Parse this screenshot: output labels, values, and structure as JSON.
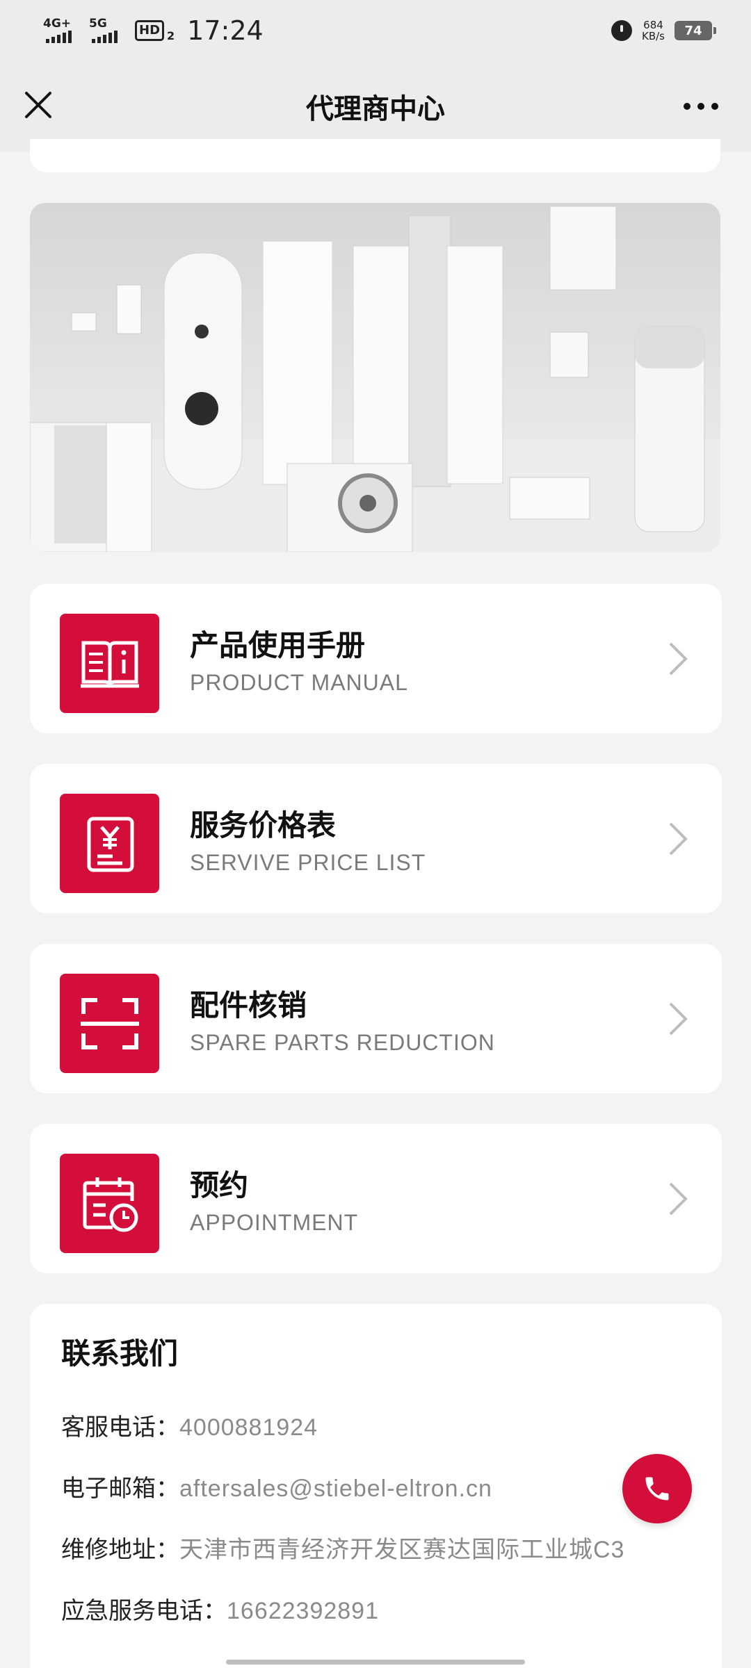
{
  "status_bar": {
    "network1": "4G+",
    "network2": "5G",
    "hd": "HD",
    "hd_sub": "2",
    "time": "17:24",
    "speed_value": "684",
    "speed_unit": "KB/s",
    "battery": "74"
  },
  "header": {
    "title": "代理商中心",
    "close_icon": "close-icon",
    "more_icon": "more-dots-icon"
  },
  "banner": {
    "description_icon": "product-banner-image"
  },
  "menu": [
    {
      "zh": "产品使用手册",
      "en": "PRODUCT MANUAL",
      "icon": "book-info-icon"
    },
    {
      "zh": "服务价格表",
      "en": "SERVIVE PRICE LIST",
      "icon": "price-list-icon"
    },
    {
      "zh": "配件核销",
      "en": "SPARE PARTS REDUCTION",
      "icon": "scan-icon"
    },
    {
      "zh": "预约",
      "en": "APPOINTMENT",
      "icon": "calendar-clock-icon"
    }
  ],
  "contact": {
    "title": "联系我们",
    "phone_label": "客服电话：",
    "phone": "4000881924",
    "email_label": "电子邮箱：",
    "email": "aftersales@stiebel-eltron.cn",
    "address_label": "维修地址：",
    "address": "天津市西青经济开发区赛达国际工业城C3",
    "emergency_label": "应急服务电话：",
    "emergency": "16622392891"
  },
  "colors": {
    "accent": "#d40e3a",
    "background": "#f3f3f3",
    "card": "#ffffff"
  }
}
